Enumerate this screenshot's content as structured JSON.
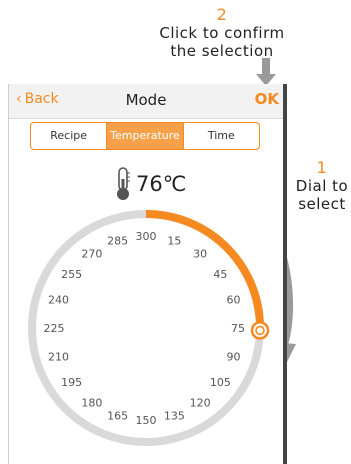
{
  "annotations": {
    "step2_number": "2",
    "step2_line1": "Click to confirm",
    "step2_line2": "the selection",
    "step1_number": "1",
    "step1_line1": "Dial to",
    "step1_line2": "select"
  },
  "header": {
    "back_label": "Back",
    "title": "Mode",
    "ok_label": "OK"
  },
  "tabs": [
    {
      "label": "Recipe",
      "active": false
    },
    {
      "label": "Temperature",
      "active": true
    },
    {
      "label": "Time",
      "active": false
    }
  ],
  "temperature": {
    "icon": "thermometer-icon",
    "value": "76℃",
    "selected_degrees": 76
  },
  "dial": {
    "min": 0,
    "max": 300,
    "labels": [
      "300",
      "15",
      "30",
      "45",
      "60",
      "75",
      "90",
      "105",
      "120",
      "135",
      "150",
      "165",
      "180",
      "195",
      "210",
      "225",
      "240",
      "255",
      "270",
      "285"
    ],
    "label_values": [
      0,
      15,
      30,
      45,
      60,
      75,
      90,
      105,
      120,
      135,
      150,
      165,
      180,
      195,
      210,
      225,
      240,
      255,
      270,
      285
    ],
    "selected_value": 76,
    "colors": {
      "track": "#d9d9d9",
      "active": "#f6891f",
      "label": "#555555",
      "arrow": "#9a9a9a"
    }
  }
}
